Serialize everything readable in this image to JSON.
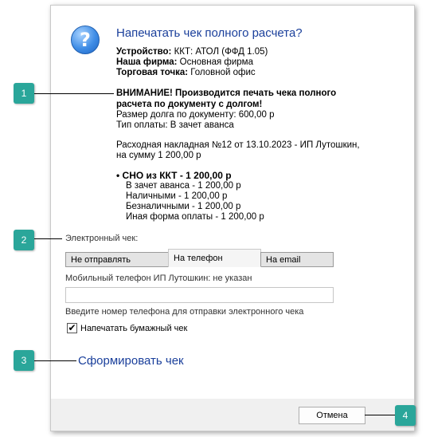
{
  "dialog": {
    "title": "Напечатать чек полного расчета?",
    "device_label": "Устройство:",
    "device_value": " ККТ: АТОЛ (ФФД 1.05)",
    "company_label": "Наша фирма:",
    "company_value": " Основная фирма",
    "point_label": "Торговая точка:",
    "point_value": " Головной офис",
    "warning": "ВНИМАНИЕ! Производится печать чека полного расчета по документу с долгом!",
    "debt": "Размер долга по документу: 600,00 р",
    "payment_type": "Тип оплаты: В зачет аванса",
    "invoice_line1": "Расходная накладная №12 от 13.10.2023 - ИП Лутошкин,",
    "invoice_line2": "на сумму 1 200,00 р",
    "sno": "• СНО из ККТ - 1 200,00 р",
    "payments": [
      "В зачет аванса - 1 200,00 р",
      "Наличными - 1 200,00 р",
      "Безналичными - 1 200,00 р",
      "Иная форма оплаты - 1 200,00 р"
    ],
    "ereceipt_label": "Электронный чек:",
    "tabs": [
      "Не отправлять",
      "На телефон",
      "На email"
    ],
    "phone_label": "Мобильный телефон ИП Лутошкин: не указан",
    "phone_value": "",
    "phone_hint": "Введите номер телефона для отправки электронного чека",
    "print_paper_label": "Напечатать бумажный чек",
    "print_paper_checked": true,
    "form_link": "Сформировать чек",
    "cancel_label": "Отмена"
  },
  "callouts": [
    "1",
    "2",
    "3",
    "4"
  ],
  "colors": {
    "accent": "#2aa69a",
    "title": "#1a3f9b"
  },
  "icons": {
    "question": "?"
  }
}
